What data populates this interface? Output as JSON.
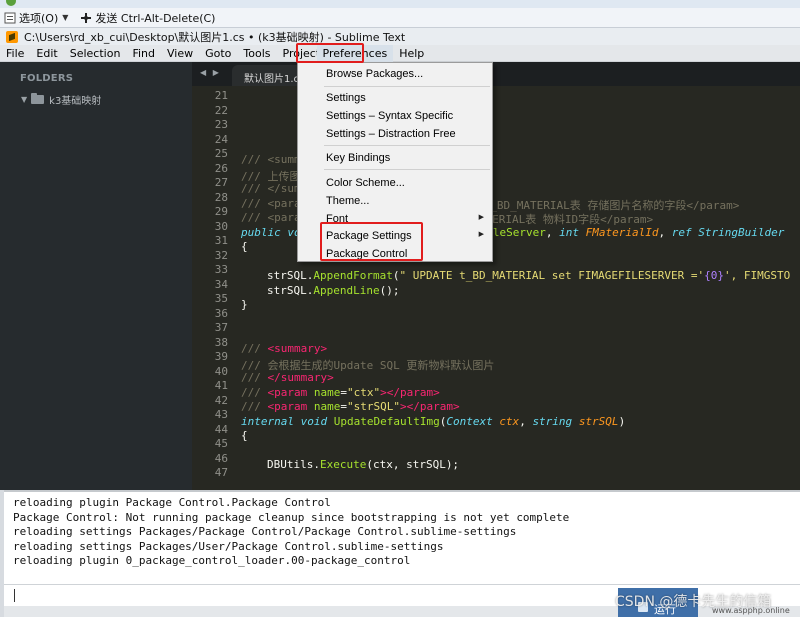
{
  "remote_toolbar": {
    "options_label": "选项(O)",
    "send_label": "发送 Ctrl-Alt-Delete(C)"
  },
  "window": {
    "title": "C:\\Users\\rd_xb_cui\\Desktop\\默认图片1.cs • (k3基础映射) - Sublime Text"
  },
  "menubar": {
    "items": [
      "File",
      "Edit",
      "Selection",
      "Find",
      "View",
      "Goto",
      "Tools",
      "Project",
      "Preferences",
      "Help"
    ]
  },
  "sidebar": {
    "folders_label": "FOLDERS",
    "root_folder": "k3基础映射"
  },
  "tab": {
    "label": "默认图片1.cs"
  },
  "preferences_menu": {
    "items": [
      {
        "label": "Browse Packages...",
        "submenu": false
      },
      {
        "label": "Settings",
        "submenu": false
      },
      {
        "label": "Settings – Syntax Specific",
        "submenu": false
      },
      {
        "label": "Settings – Distraction Free",
        "submenu": false
      },
      {
        "label": "Key Bindings",
        "submenu": false
      },
      {
        "label": "Color Scheme...",
        "submenu": false
      },
      {
        "label": "Theme...",
        "submenu": false
      },
      {
        "label": "Font",
        "submenu": true
      },
      {
        "label": "Package Settings",
        "submenu": true
      },
      {
        "label": "Package Control",
        "submenu": false
      }
    ]
  },
  "editor": {
    "line_numbers": [
      "21",
      "22",
      "23",
      "24",
      "25",
      "26",
      "27",
      "28",
      "29",
      "30",
      "31",
      "32",
      "33",
      "34",
      "35",
      "36",
      "37",
      "38",
      "39",
      "40",
      "41",
      "42",
      "43",
      "44",
      "45",
      "46",
      "47"
    ],
    "code": {
      "l25": "/// <summary>",
      "l26": "/// 上传图片的SQL",
      "l27": "/// </summary>",
      "l28a": "/// <param name=\"",
      "l28b": "至 t_BD_MATERIAL表 存储图片名称的字段</param>",
      "l29a": "/// <param",
      "l29b": "D_MATERIAL表 物料ID字段</param>",
      "l30": [
        "public vo",
        "eFileServer",
        ", ",
        "int",
        " ",
        "FMaterialId",
        ", ",
        "ref",
        " ",
        "StringBuilder"
      ],
      "l31": "{",
      "l33": [
        "strSQL",
        ".",
        "AppendFormat",
        "(",
        "\" UPDATE t_BD_MATERIAL set FIMAGEFILESERVER ='",
        "{0}",
        "', FIMGSTO"
      ],
      "l34": [
        "strSQL",
        ".",
        "AppendLine",
        "();"
      ],
      "l35": "}",
      "l38": [
        "/// ",
        "<summary>"
      ],
      "l39": "/// 会根据生成的Update SQL 更新物料默认图片",
      "l40": [
        "/// ",
        "</summary>"
      ],
      "l41": [
        "/// ",
        "<param ",
        "name",
        "=",
        "\"ctx\"",
        "></param>"
      ],
      "l42": [
        "/// ",
        "<param ",
        "name",
        "=",
        "\"strSQL\"",
        "></param>"
      ],
      "l43": [
        "internal",
        " ",
        "void",
        " ",
        "UpdateDefaultImg",
        "(",
        "Context",
        " ",
        "ctx",
        ", ",
        "string",
        " ",
        "strSQL",
        ")"
      ],
      "l44": "{",
      "l46": [
        "DBUtils",
        ".",
        "Execute",
        "(ctx, strSQL);"
      ]
    }
  },
  "console": {
    "lines": [
      "reloading plugin Package Control.Package Control",
      "Package Control: Not running package cleanup since bootstrapping is not yet complete",
      "reloading settings Packages/Package Control/Package Control.sublime-settings",
      "reloading settings Packages/User/Package Control.sublime-settings",
      "reloading plugin 0_package_control_loader.00-package_control"
    ],
    "input_value": ""
  },
  "run_button": {
    "label": "运行"
  },
  "watermark": {
    "text": "CSDN @德卡先生的信箱",
    "site": "www.aspphp.online"
  },
  "colors": {
    "editor_bg": "#272822",
    "sidebar_bg": "#262b2e",
    "highlight": "#e11d1d",
    "menu_bg": "#f1f1f1"
  },
  "icons": [
    "sublime-text-icon",
    "folder-icon",
    "caret-down-icon",
    "chevron-right-icon",
    "ctrl-alt-del-icon"
  ]
}
